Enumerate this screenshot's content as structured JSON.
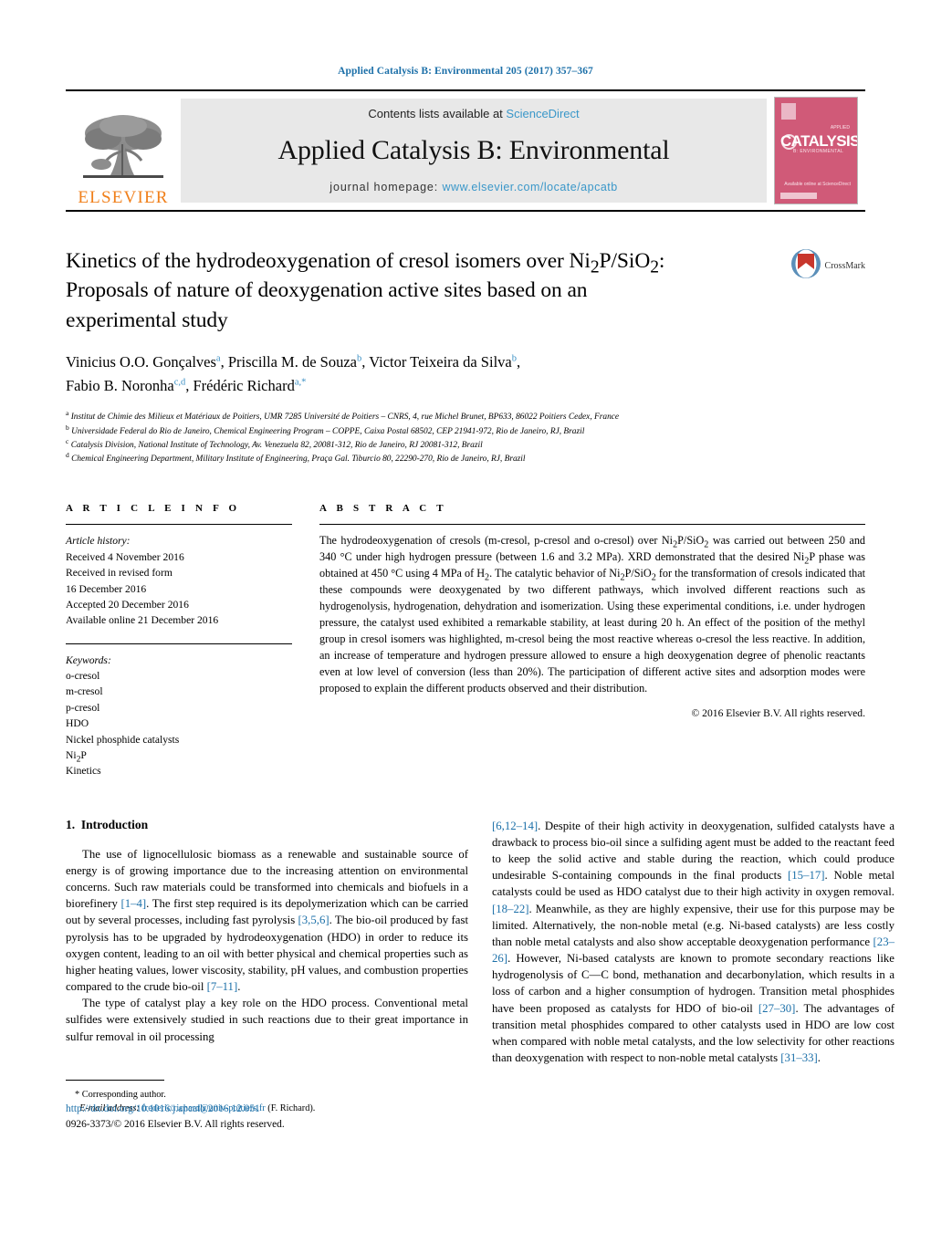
{
  "running_head": "Applied Catalysis B: Environmental 205 (2017) 357–367",
  "masthead": {
    "contents_prefix": "Contents lists available at",
    "sciencedirect": "ScienceDirect",
    "journal_title": "Applied Catalysis B: Environmental",
    "homepage_prefix": "journal homepage:",
    "homepage_url": "www.elsevier.com/locate/apcatb",
    "publisher": "ELSEVIER",
    "cover": {
      "word": "CATALYSIS",
      "subtitle": "B: ENVIRONMENTAL",
      "top_right": "APPLIED",
      "footer": "Available online at\nScienceDirect"
    },
    "colors": {
      "link": "#3a97c9",
      "elsevier_orange": "#f07f1a",
      "cover_pink": "#d05a78",
      "box_grey": "#e8e8e8"
    }
  },
  "title": {
    "line1": "Kinetics of the hydrodeoxygenation of cresol isomers over Ni",
    "sub1": "2",
    "line1b": "P/SiO",
    "sub2": "2",
    "line1c": ":",
    "line2": "Proposals of nature of deoxygenation active sites based on an",
    "line3": "experimental study",
    "full": "Kinetics of the hydrodeoxygenation of cresol isomers over Ni2P/SiO2: Proposals of nature of deoxygenation active sites based on an experimental study"
  },
  "crossmark": {
    "label": "CrossMark"
  },
  "authors": [
    {
      "name": "Vinicius O.O. Gonçalves",
      "marks": "a"
    },
    {
      "name": "Priscilla M. de Souza",
      "marks": "b"
    },
    {
      "name": "Victor Teixeira da Silva",
      "marks": "b"
    },
    {
      "name": "Fabio B. Noronha",
      "marks": "c,d"
    },
    {
      "name": "Frédéric Richard",
      "marks": "a,*"
    }
  ],
  "affiliations": [
    {
      "mark": "a",
      "text": "Institut de Chimie des Milieux et Matériaux de Poitiers, UMR 7285 Université de Poitiers – CNRS, 4, rue Michel Brunet, BP633, 86022 Poitiers Cedex, France"
    },
    {
      "mark": "b",
      "text": "Universidade Federal do Rio de Janeiro, Chemical Engineering Program – COPPE, Caixa Postal 68502, CEP 21941-972, Rio de Janeiro, RJ, Brazil"
    },
    {
      "mark": "c",
      "text": "Catalysis Division, National Institute of Technology, Av. Venezuela 82, 20081-312, Rio de Janeiro, RJ 20081-312, Brazil"
    },
    {
      "mark": "d",
      "text": "Chemical Engineering Department, Military Institute of Engineering, Praça Gal. Tiburcio 80, 22290-270, Rio de Janeiro, RJ, Brazil"
    }
  ],
  "article_info": {
    "heading": "A R T I C L E  I N F O",
    "history_label": "Article history:",
    "history": [
      "Received 4 November 2016",
      "Received in revised form",
      "16 December 2016",
      "Accepted 20 December 2016",
      "Available online 21 December 2016"
    ],
    "keywords_label": "Keywords:",
    "keywords": [
      "o-cresol",
      "m-cresol",
      "p-cresol",
      "HDO",
      "Nickel phosphide catalysts",
      "Ni2P",
      "Kinetics"
    ]
  },
  "abstract": {
    "heading": "A B S T R A C T",
    "text": "The hydrodeoxygenation of cresols (m-cresol, p-cresol and o-cresol) over Ni2P/SiO2 was carried out between 250 and 340 °C under high hydrogen pressure (between 1.6 and 3.2 MPa). XRD demonstrated that the desired Ni2P phase was obtained at 450 °C using 4 MPa of H2. The catalytic behavior of Ni2P/SiO2 for the transformation of cresols indicated that these compounds were deoxygenated by two different pathways, which involved different reactions such as hydrogenolysis, hydrogenation, dehydration and isomerization. Using these experimental conditions, i.e. under hydrogen pressure, the catalyst used exhibited a remarkable stability, at least during 20 h. An effect of the position of the methyl group in cresol isomers was highlighted, m-cresol being the most reactive whereas o-cresol the less reactive. In addition, an increase of temperature and hydrogen pressure allowed to ensure a high deoxygenation degree of phenolic reactants even at low level of conversion (less than 20%). The participation of different active sites and adsorption modes were proposed to explain the different products observed and their distribution.",
    "copyright": "© 2016 Elsevier B.V. All rights reserved."
  },
  "introduction": {
    "section_number": "1.",
    "section_title": "Introduction",
    "left_paragraphs": [
      "The use of lignocellulosic biomass as a renewable and sustainable source of energy is of growing importance due to the increasing attention on environmental concerns. Such raw materials could be transformed into chemicals and biofuels in a biorefinery [1–4]. The first step required is its depolymerization which can be carried out by several processes, including fast pyrolysis [3,5,6]. The bio-oil produced by fast pyrolysis has to be upgraded by hydrodeoxygenation (HDO) in order to reduce its oxygen content, leading to an oil with better physical and chemical properties such as higher heating values, lower viscosity, stability, pH values, and combustion properties compared to the crude bio-oil [7–11].",
      "The type of catalyst play a key role on the HDO process. Conventional metal sulfides were extensively studied in such reactions due to their great importance in sulfur removal in oil processing"
    ],
    "right_paragraphs": [
      "[6,12–14]. Despite of their high activity in deoxygenation, sulfided catalysts have a drawback to process bio-oil since a sulfiding agent must be added to the reactant feed to keep the solid active and stable during the reaction, which could produce undesirable S-containing compounds in the final products [15–17]. Noble metal catalysts could be used as HDO catalyst due to their high activity in oxygen removal. [18–22]. Meanwhile, as they are highly expensive, their use for this purpose may be limited. Alternatively, the non-noble metal (e.g. Ni-based catalysts) are less costly than noble metal catalysts and also show acceptable deoxygenation performance [23–26]. However, Ni-based catalysts are known to promote secondary reactions like hydrogenolysis of C—C bond, methanation and decarbonylation, which results in a loss of carbon and a higher consumption of hydrogen. Transition metal phosphides have been proposed as catalysts for HDO of bio-oil [27–30]. The advantages of transition metal phosphides compared to other catalysts used in HDO are low cost when compared with noble metal catalysts, and the low selectivity for other reactions than deoxygenation with respect to non-noble metal catalysts [31–33]."
    ]
  },
  "footnote": {
    "star": "*",
    "corresponding": "Corresponding author.",
    "email_label": "E-mail address:",
    "email": "frederic.richard@univ-poitiers.fr",
    "email_suffix": "(F. Richard)."
  },
  "page_footer": {
    "doi": "http://dx.doi.org/10.1016/j.apcatb.2016.12.051",
    "issn": "0926-3373/© 2016 Elsevier B.V. All rights reserved."
  }
}
